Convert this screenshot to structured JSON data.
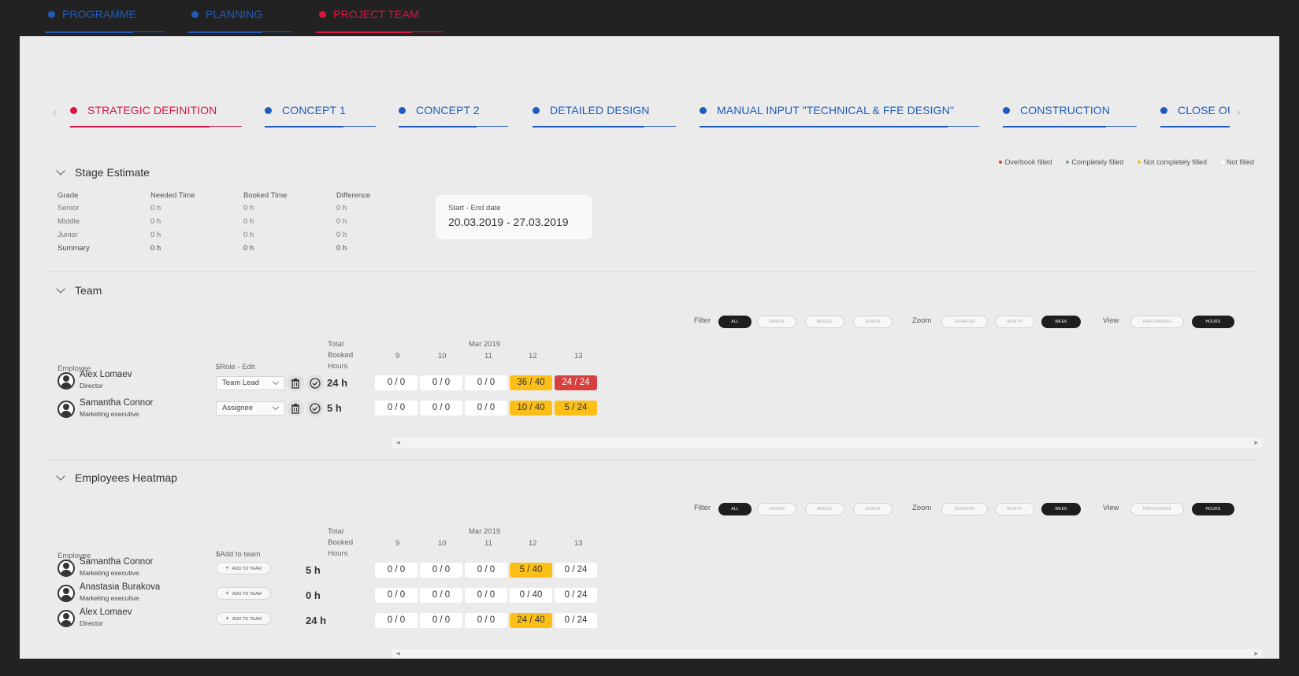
{
  "top_nav": [
    {
      "label": "PROGRAMME",
      "active": false
    },
    {
      "label": "PLANNING",
      "active": false
    },
    {
      "label": "PROJECT TEAM",
      "active": true
    }
  ],
  "colors": {
    "blue": "#1f5bbd",
    "red": "#dc1444",
    "amber": "#fbbf18",
    "overbook": "#d6403f",
    "panel": "#ebebeb",
    "page_bg": "#222223"
  },
  "stages": {
    "prev_icon": "chevron-left-icon",
    "next_icon": "chevron-right-icon",
    "items": [
      {
        "label": "STRATEGIC DEFINITION",
        "active": true
      },
      {
        "label": "CONCEPT 1",
        "active": false
      },
      {
        "label": "CONCEPT 2",
        "active": false
      },
      {
        "label": "DETAILED DESIGN",
        "active": false
      },
      {
        "label": "MANUAL INPUT \"TECHNICAL & FFE DESIGN\"",
        "active": false
      },
      {
        "label": "CONSTRUCTION",
        "active": false
      },
      {
        "label": "CLOSE OU",
        "active": false
      }
    ]
  },
  "legend": [
    {
      "label": "Overbook filled",
      "color": "#d6403f"
    },
    {
      "label": "Completely filled",
      "color": "#7aa8a0"
    },
    {
      "label": "Not completely filled",
      "color": "#fbbf18"
    },
    {
      "label": "Not filled",
      "color": "#ffffff"
    }
  ],
  "stage_estimate": {
    "title": "Stage Estimate",
    "headers": [
      "Grade",
      "Needed Time",
      "Booked Time",
      "Difference"
    ],
    "rows": [
      [
        "Senior",
        "0 h",
        "0 h",
        "0 h"
      ],
      [
        "Middle",
        "0 h",
        "0 h",
        "0 h"
      ],
      [
        "Junior",
        "0 h",
        "0 h",
        "0 h"
      ],
      [
        "Summary",
        "0 h",
        "0 h",
        "0 h"
      ]
    ],
    "date_card": {
      "title": "Start - End date",
      "value": "20.03.2019 - 27.03.2019"
    }
  },
  "controls": {
    "filter_label": "Filter",
    "filter_options": [
      "ALL",
      "SENIOR",
      "MIDDLE",
      "JUNIOR"
    ],
    "filter_selected": "ALL",
    "zoom_label": "Zoom",
    "zoom_options": [
      "QUARTER",
      "MONTH",
      "WEEK"
    ],
    "zoom_selected": "WEEK",
    "view_label": "View",
    "view_options": [
      "PERCENTAGE",
      "HOURS"
    ],
    "view_selected": "HOURS"
  },
  "team": {
    "title": "Team",
    "col_employee": "Employee",
    "col_role": "$Role - Edit",
    "col_total": [
      "Total",
      "Booked",
      "Hours"
    ],
    "month": "Mar 2019",
    "weeks": [
      "9",
      "10",
      "11",
      "12",
      "13"
    ],
    "members": [
      {
        "name": "Alex Lomaev",
        "role": "Director",
        "select": "Team Lead",
        "hours": "24 h",
        "cells": [
          {
            "v": "0 / 0",
            "s": "none"
          },
          {
            "v": "0 / 0",
            "s": "none"
          },
          {
            "v": "0 / 0",
            "s": "none"
          },
          {
            "v": "36 / 40",
            "s": "partial"
          },
          {
            "v": "24 / 24",
            "s": "over"
          }
        ]
      },
      {
        "name": "Samantha Connor",
        "role": "Marketing executive",
        "select": "Assignee",
        "hours": "5 h",
        "cells": [
          {
            "v": "0 / 0",
            "s": "none"
          },
          {
            "v": "0 / 0",
            "s": "none"
          },
          {
            "v": "0 / 0",
            "s": "none"
          },
          {
            "v": "10 / 40",
            "s": "partial"
          },
          {
            "v": "5 / 24",
            "s": "partial"
          }
        ]
      }
    ]
  },
  "heatmap": {
    "title": "Employees Heatmap",
    "col_employee": "Employee",
    "col_add": "$Add to team",
    "col_total": [
      "Total",
      "Booked",
      "Hours"
    ],
    "month": "Mar 2019",
    "weeks": [
      "9",
      "10",
      "11",
      "12",
      "13"
    ],
    "add_label": "ADD TO TEAM",
    "members": [
      {
        "name": "Samantha Connor",
        "role": "Marketing executive",
        "hours": "5 h",
        "cells": [
          {
            "v": "0 / 0",
            "s": "none"
          },
          {
            "v": "0 / 0",
            "s": "none"
          },
          {
            "v": "0 / 0",
            "s": "none"
          },
          {
            "v": "5 / 40",
            "s": "partial"
          },
          {
            "v": "0 / 24",
            "s": "none"
          }
        ]
      },
      {
        "name": "Anastasia Burakova",
        "role": "Marketing executive",
        "hours": "0 h",
        "cells": [
          {
            "v": "0 / 0",
            "s": "none"
          },
          {
            "v": "0 / 0",
            "s": "none"
          },
          {
            "v": "0 / 0",
            "s": "none"
          },
          {
            "v": "0 / 40",
            "s": "none"
          },
          {
            "v": "0 / 24",
            "s": "none"
          }
        ]
      },
      {
        "name": "Alex Lomaev",
        "role": "Director",
        "hours": "24 h",
        "cells": [
          {
            "v": "0 / 0",
            "s": "none"
          },
          {
            "v": "0 / 0",
            "s": "none"
          },
          {
            "v": "0 / 0",
            "s": "none"
          },
          {
            "v": "24 / 40",
            "s": "partial"
          },
          {
            "v": "0 / 24",
            "s": "none"
          }
        ]
      }
    ]
  }
}
